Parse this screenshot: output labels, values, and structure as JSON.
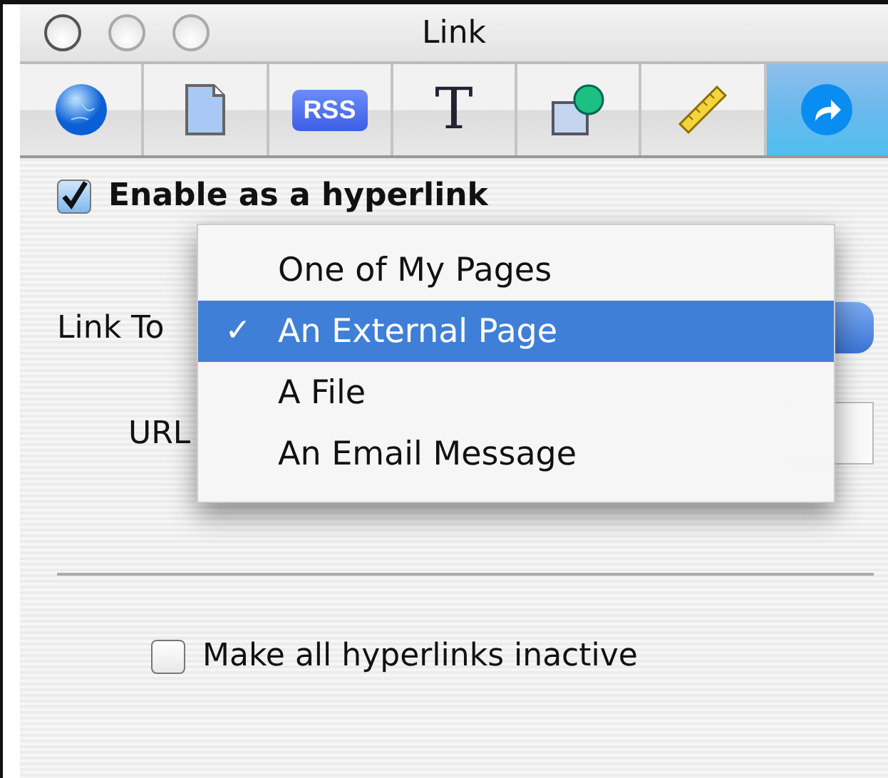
{
  "window": {
    "title": "Link"
  },
  "toolbar": [
    {
      "kind": "globe",
      "selected": false
    },
    {
      "kind": "document",
      "selected": false
    },
    {
      "kind": "rss",
      "label": "RSS",
      "selected": false
    },
    {
      "kind": "text",
      "label": "T",
      "selected": false
    },
    {
      "kind": "shapes",
      "selected": false
    },
    {
      "kind": "ruler",
      "selected": false
    },
    {
      "kind": "link",
      "selected": true
    }
  ],
  "enable_hyperlink": {
    "label": "Enable as a hyperlink",
    "checked": true
  },
  "link_to": {
    "label": "Link To"
  },
  "url": {
    "label": "URL"
  },
  "menu": {
    "check_mark": "✓",
    "items": [
      {
        "label": "One of My Pages",
        "selected": false
      },
      {
        "label": "An External Page",
        "selected": true
      },
      {
        "label": "A File",
        "selected": false
      },
      {
        "label": "An Email Message",
        "selected": false
      }
    ]
  },
  "inactive_links": {
    "label": "Make all hyperlinks inactive",
    "checked": false
  }
}
